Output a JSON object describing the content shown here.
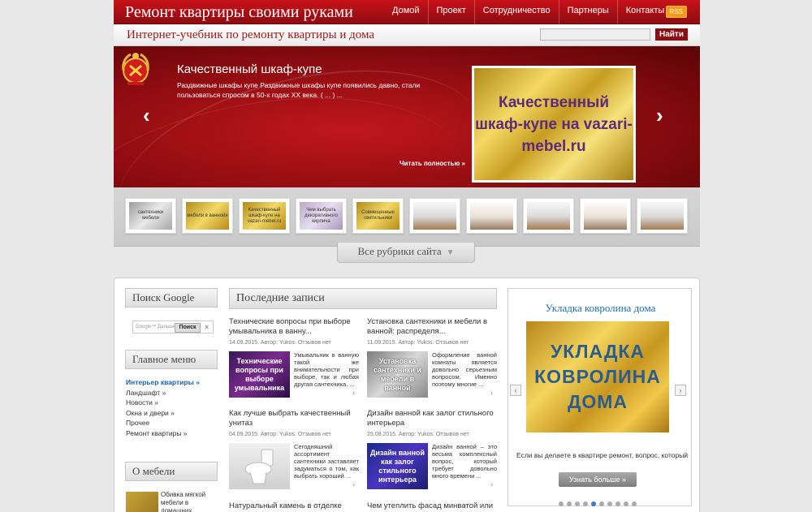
{
  "header": {
    "site_title": "Ремонт квартиры своими руками",
    "nav": [
      "Домой",
      "Проект",
      "Сотрудничество",
      "Партнеры",
      "Контакты"
    ],
    "rss_label": "RSS",
    "tagline": "Интернет-учебник по ремонту квартиры и дома",
    "search_button": "Найти"
  },
  "slider": {
    "title": "Качественный шкаф-купе",
    "text": "Раздвижные шкафы купе Раздвижные шкафы купе появились давно, стали пользоваться спросом в 50-х годах XX века. ( ... ) ...",
    "read_more": "Читать полностью »",
    "image_text": "Качественный шкаф-купе на vazari-mebel.ru",
    "prev_icon": "‹",
    "next_icon": "›"
  },
  "thumbs": [
    {
      "label": "сантехники мебели",
      "style": "silver"
    },
    {
      "label": "мебели в ваннойя",
      "style": "gold"
    },
    {
      "label": "Качественный шкаф-купе на vazari-mebel.ru",
      "style": "gold"
    },
    {
      "label": "Чем выбрать декоративного кирпича",
      "style": "mauve"
    },
    {
      "label": "Совмещенные светильники",
      "style": "gold"
    },
    {
      "label": "",
      "style": "room"
    },
    {
      "label": "",
      "style": "room2"
    },
    {
      "label": "",
      "style": "room"
    },
    {
      "label": "",
      "style": "room2"
    },
    {
      "label": "",
      "style": "room"
    }
  ],
  "all_rubrics": "Все рубрики сайта",
  "sidebar": {
    "google_head": "Поиск Google",
    "google_placeholder": "Google™ Дальше",
    "google_button": "Поиск",
    "google_close": "×",
    "menu_head": "Главное меню",
    "menu": [
      "Интерьер квартиры »",
      "Ландшафт »",
      "Новости »",
      "Окна и двери »",
      "Прочее",
      "Ремонт квартиры »"
    ],
    "about_head": "О мебели",
    "about_text": "Обивка мягкой мебели в домашних"
  },
  "posts": {
    "head": "Последние записи",
    "items": [
      {
        "title": "Технические вопросы при выборе умывальника в ванну...",
        "meta": "14.09.2015. Автор: Yukos. Отзывов нет",
        "img_text": "Технические вопросы при выборе умывальника",
        "img_style": "purple",
        "text": "Умывальник в ванную такой же внимательности при выборе, так и любая другая сантехника. ..."
      },
      {
        "title": "Установка сантехники и мебели в ванной: распределя...",
        "meta": "11.09.2015. Автор: Yukos. Отзывов нет",
        "img_text": "Установка сантехники и мебели в ванной",
        "img_style": "silver",
        "text": "Оформление ванной комнаты является довольно серьезным вопросом. Именно поэтому многие ..."
      },
      {
        "title": "Как лучше выбрать качественный унитаз",
        "meta": "04.09.2015. Автор: Yukos. Отзывов нет",
        "img_text": "",
        "img_style": "toilet",
        "text": "Сегодняшний ассортимент сантехники заставляет задуматься о том, как выбрать хороший ..."
      },
      {
        "title": "Дизайн ванной как залог стильного интерьера",
        "meta": "25.08.2015. Автор: Yukos. Отзывов нет",
        "img_text": "Дизайн ванной как залог стильного интерьера",
        "img_style": "blue",
        "text": "Дизайн ванной – это весьма комплексный вопрос, который требует довольно много времени ..."
      },
      {
        "title": "Натуральный камень в отделке",
        "meta": "",
        "img_text": "",
        "img_style": "",
        "text": ""
      },
      {
        "title": "Чем утеплить фасад минватой или",
        "meta": "",
        "img_text": "",
        "img_style": "",
        "text": ""
      }
    ]
  },
  "widget": {
    "title": "Укладка ковролина дома",
    "image_text": "УКЛАДКА КОВРОЛИНА ДОМА",
    "text": "Если вы делаете в квартире ремонт, вопрос, который встанет на повестку дня, - возможно ли",
    "button": "Узнать больше »",
    "prev_icon": "‹",
    "next_icon": "›",
    "dots_count": 10,
    "active_dot": 4
  }
}
